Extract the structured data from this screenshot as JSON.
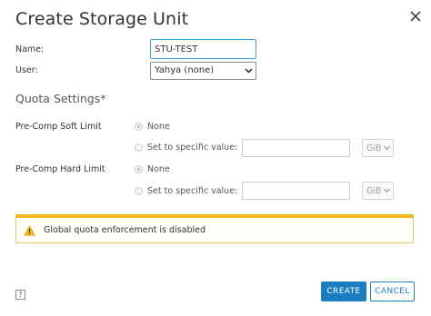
{
  "dialog": {
    "title": "Create Storage Unit"
  },
  "form": {
    "name_label": "Name:",
    "name_value": "STU-TEST",
    "user_label": "User:",
    "user_value": "Yahya (none)"
  },
  "quota": {
    "section_title": "Quota Settings*",
    "soft": {
      "label": "Pre-Comp Soft Limit",
      "option_none": "None",
      "option_specific": "Set to specific value:",
      "value": "",
      "unit": "GiB",
      "selected": "none"
    },
    "hard": {
      "label": "Pre-Comp Hard Limit",
      "option_none": "None",
      "option_specific": "Set to specific value:",
      "value": "",
      "unit": "GiB",
      "selected": "none"
    }
  },
  "alert": {
    "message": "Global quota enforcement is disabled",
    "icon": "warning-icon",
    "color": "#f2b81c"
  },
  "footer": {
    "help_label": "?",
    "create_label": "CREATE",
    "cancel_label": "CANCEL"
  },
  "colors": {
    "primary": "#1a7dc0",
    "focus_border": "#39a3d8"
  }
}
